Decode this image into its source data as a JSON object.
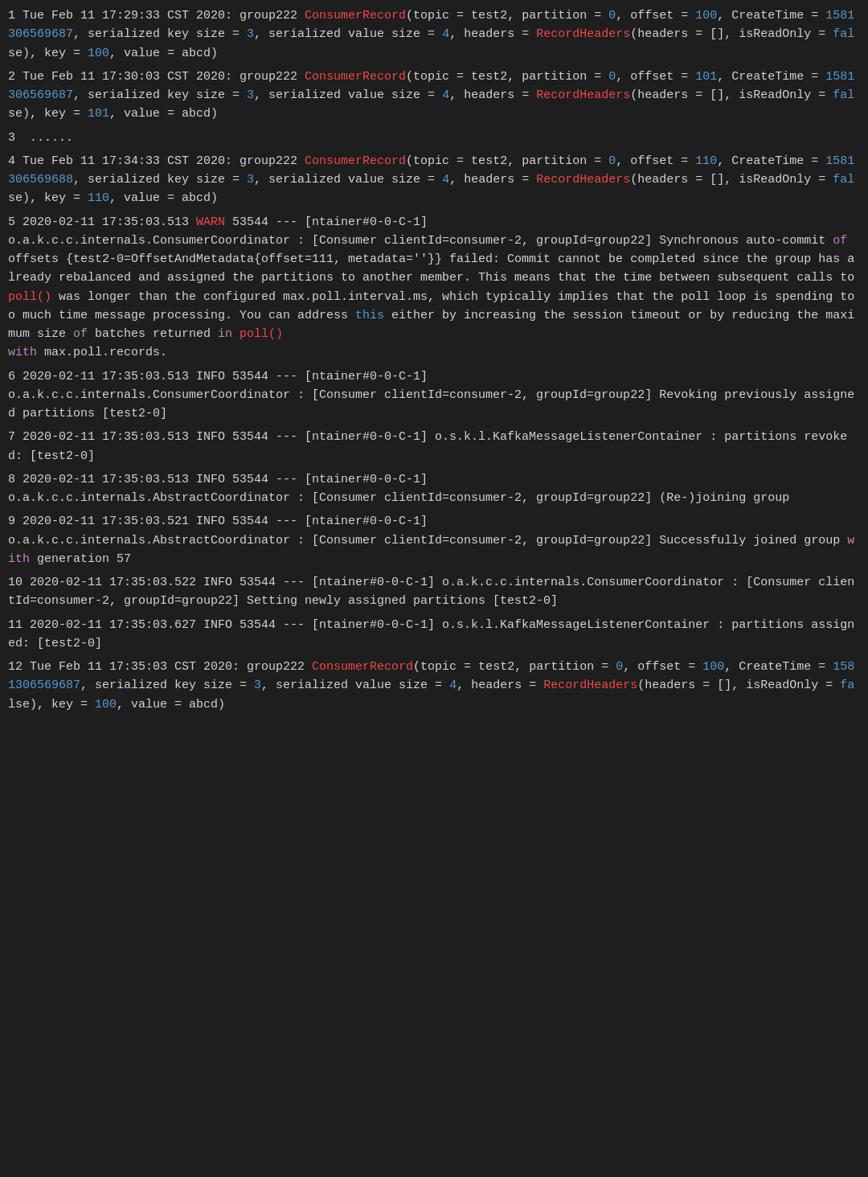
{
  "log": {
    "entries": [
      {
        "num": "1",
        "text_parts": [
          {
            "t": " Tue Feb 11 17:29:33 CST 2020: group222 ",
            "c": "normal"
          },
          {
            "t": "ConsumerRecord",
            "c": "keyword-red"
          },
          {
            "t": "(topic = test2, partition = ",
            "c": "normal"
          },
          {
            "t": "0",
            "c": "keyword-blue"
          },
          {
            "t": ", offset = ",
            "c": "normal"
          },
          {
            "t": "100",
            "c": "keyword-blue"
          },
          {
            "t": ", CreateTime = ",
            "c": "normal"
          },
          {
            "t": "1581306569687",
            "c": "keyword-blue"
          },
          {
            "t": ", serialized key size = ",
            "c": "normal"
          },
          {
            "t": "3",
            "c": "keyword-blue"
          },
          {
            "t": ", serialized value size = ",
            "c": "normal"
          },
          {
            "t": "4",
            "c": "keyword-blue"
          },
          {
            "t": ", headers = ",
            "c": "normal"
          },
          {
            "t": "RecordHeaders",
            "c": "keyword-red"
          },
          {
            "t": "(headers = [], isReadOnly = ",
            "c": "normal"
          },
          {
            "t": "fal",
            "c": "keyword-blue"
          },
          {
            "t": "se), key = ",
            "c": "normal"
          },
          {
            "t": "100",
            "c": "keyword-blue"
          },
          {
            "t": ", value = abcd)",
            "c": "normal"
          }
        ]
      },
      {
        "num": "2",
        "text_parts": [
          {
            "t": " Tue Feb 11 17:30:03 CST 2020: group222 ",
            "c": "normal"
          },
          {
            "t": "ConsumerRecord",
            "c": "keyword-red"
          },
          {
            "t": "(topic = test2, partition = ",
            "c": "normal"
          },
          {
            "t": "0",
            "c": "keyword-blue"
          },
          {
            "t": ", offset = ",
            "c": "normal"
          },
          {
            "t": "101",
            "c": "keyword-blue"
          },
          {
            "t": ", CreateTime = ",
            "c": "normal"
          },
          {
            "t": "1581306569687",
            "c": "keyword-blue"
          },
          {
            "t": ", serialized key size = ",
            "c": "normal"
          },
          {
            "t": "3",
            "c": "keyword-blue"
          },
          {
            "t": ", serialized value size = ",
            "c": "normal"
          },
          {
            "t": "4",
            "c": "keyword-blue"
          },
          {
            "t": ", headers = ",
            "c": "normal"
          },
          {
            "t": "RecordHeaders",
            "c": "keyword-red"
          },
          {
            "t": "(headers = [], isReadOnly = ",
            "c": "normal"
          },
          {
            "t": "fal",
            "c": "keyword-blue"
          },
          {
            "t": "se), key = ",
            "c": "normal"
          },
          {
            "t": "101",
            "c": "keyword-blue"
          },
          {
            "t": ", value = abcd)",
            "c": "normal"
          }
        ]
      },
      {
        "num": "3",
        "text_parts": [
          {
            "t": "  ......",
            "c": "normal"
          }
        ]
      },
      {
        "num": "4",
        "text_parts": [
          {
            "t": " Tue Feb 11 17:34:33 CST 2020: group222 ",
            "c": "normal"
          },
          {
            "t": "ConsumerRecord",
            "c": "keyword-red"
          },
          {
            "t": "(topic = test2, partition = ",
            "c": "normal"
          },
          {
            "t": "0",
            "c": "keyword-blue"
          },
          {
            "t": ", offset = ",
            "c": "normal"
          },
          {
            "t": "110",
            "c": "keyword-blue"
          },
          {
            "t": ", CreateTime = ",
            "c": "normal"
          },
          {
            "t": "1581306569688",
            "c": "keyword-blue"
          },
          {
            "t": ", serialized key size = ",
            "c": "normal"
          },
          {
            "t": "3",
            "c": "keyword-blue"
          },
          {
            "t": ", serialized value size = ",
            "c": "normal"
          },
          {
            "t": "4",
            "c": "keyword-blue"
          },
          {
            "t": ", headers = ",
            "c": "normal"
          },
          {
            "t": "RecordHeaders",
            "c": "keyword-red"
          },
          {
            "t": "(headers = [], isReadOnly = ",
            "c": "normal"
          },
          {
            "t": "fal",
            "c": "keyword-blue"
          },
          {
            "t": "se), key = ",
            "c": "normal"
          },
          {
            "t": "110",
            "c": "keyword-blue"
          },
          {
            "t": ", value = abcd)",
            "c": "normal"
          }
        ]
      },
      {
        "num": "5",
        "text_parts": [
          {
            "t": " 2020-02-11 17:35:03.513 ",
            "c": "normal"
          },
          {
            "t": "WARN",
            "c": "warn"
          },
          {
            "t": " 53544 --- [ntainer#0-0-C-1]\no.a.k.c.c.internals.ConsumerCoordinator : [Consumer clientId=consumer-2, groupId=group22] Synchronous auto-commit ",
            "c": "normal"
          },
          {
            "t": "of",
            "c": "keyword-pink"
          },
          {
            "t": " offsets {test2-0=OffsetAndMetadata{offset=111, metadata=''}} failed: Commit cannot be completed since the group has already rebalanced and assigned the partitions to another member. This means that the time between subsequent calls to ",
            "c": "normal"
          },
          {
            "t": "poll()",
            "c": "keyword-red"
          },
          {
            "t": " was longer than the configured max.poll.interval.ms, which typically implies that the poll loop is spending too much time message processing. You can address ",
            "c": "normal"
          },
          {
            "t": "this",
            "c": "keyword-blue"
          },
          {
            "t": " either by increasing the session timeout or by reducing the maximum size ",
            "c": "normal"
          },
          {
            "t": "of",
            "c": "keyword-pink"
          },
          {
            "t": " batches returned ",
            "c": "normal"
          },
          {
            "t": "in",
            "c": "keyword-pink"
          },
          {
            "t": " ",
            "c": "normal"
          },
          {
            "t": "poll()",
            "c": "keyword-red"
          },
          {
            "t": "\n",
            "c": "normal"
          },
          {
            "t": "with",
            "c": "keyword-pink"
          },
          {
            "t": " max.poll.records.",
            "c": "normal"
          }
        ]
      },
      {
        "num": "6",
        "text_parts": [
          {
            "t": " 2020-02-11 17:35:03.513 INFO 53544 --- [ntainer#0-0-C-1]\no.a.k.c.c.internals.ConsumerCoordinator : [Consumer clientId=consumer-2, groupId=group22] Revoking previously assigned partitions [test2-0]",
            "c": "normal"
          }
        ]
      },
      {
        "num": "7",
        "text_parts": [
          {
            "t": " 2020-02-11 17:35:03.513 INFO 53544 --- [ntainer#0-0-C-1] o.s.k.l.KafkaMessageListenerContainer : partitions revoked: [test2-0]",
            "c": "normal"
          }
        ]
      },
      {
        "num": "8",
        "text_parts": [
          {
            "t": " 2020-02-11 17:35:03.513 INFO 53544 --- [ntainer#0-0-C-1]\no.a.k.c.c.internals.AbstractCoordinator : [Consumer clientId=consumer-2, groupId=group22] (Re-)joining group",
            "c": "normal"
          }
        ]
      },
      {
        "num": "9",
        "text_parts": [
          {
            "t": " 2020-02-11 17:35:03.521 INFO 53544 --- [ntainer#0-0-C-1]\no.a.k.c.c.internals.AbstractCoordinator : [Consumer clientId=consumer-2, groupId=group22] Successfully joined group ",
            "c": "normal"
          },
          {
            "t": "with",
            "c": "keyword-pink"
          },
          {
            "t": " generation 57",
            "c": "normal"
          }
        ]
      },
      {
        "num": "10",
        "text_parts": [
          {
            "t": " 2020-02-11 17:35:03.522 INFO 53544 --- [ntainer#0-0-C-1] o.a.k.c.c.internals.ConsumerCoordinator : [Consumer clientId=consumer-2, groupId=group22] Setting newly assigned partitions [test2-0]",
            "c": "normal"
          }
        ]
      },
      {
        "num": "11",
        "text_parts": [
          {
            "t": " 2020-02-11 17:35:03.627 INFO 53544 --- [ntainer#0-0-C-1] o.s.k.l.KafkaMessageListenerContainer : partitions assigned: [test2-0]",
            "c": "normal"
          }
        ]
      },
      {
        "num": "12",
        "text_parts": [
          {
            "t": " Tue Feb 11 17:35:03 CST 2020: group222 ",
            "c": "normal"
          },
          {
            "t": "ConsumerRecord",
            "c": "keyword-red"
          },
          {
            "t": "(topic = test2, partition = ",
            "c": "normal"
          },
          {
            "t": "0",
            "c": "keyword-blue"
          },
          {
            "t": ", offset = ",
            "c": "normal"
          },
          {
            "t": "100",
            "c": "keyword-blue"
          },
          {
            "t": ", CreateTime = ",
            "c": "normal"
          },
          {
            "t": "1581306569687",
            "c": "keyword-blue"
          },
          {
            "t": ", serialized key size = ",
            "c": "normal"
          },
          {
            "t": "3",
            "c": "keyword-blue"
          },
          {
            "t": ", serialized value size = ",
            "c": "normal"
          },
          {
            "t": "4",
            "c": "keyword-blue"
          },
          {
            "t": ", headers = ",
            "c": "normal"
          },
          {
            "t": "RecordHeaders",
            "c": "keyword-red"
          },
          {
            "t": "(headers = [], isReadOnly = ",
            "c": "normal"
          },
          {
            "t": "fa",
            "c": "keyword-blue"
          },
          {
            "t": "lse), key = ",
            "c": "normal"
          },
          {
            "t": "100",
            "c": "keyword-blue"
          },
          {
            "t": ", value = abcd)",
            "c": "normal"
          }
        ]
      }
    ]
  }
}
